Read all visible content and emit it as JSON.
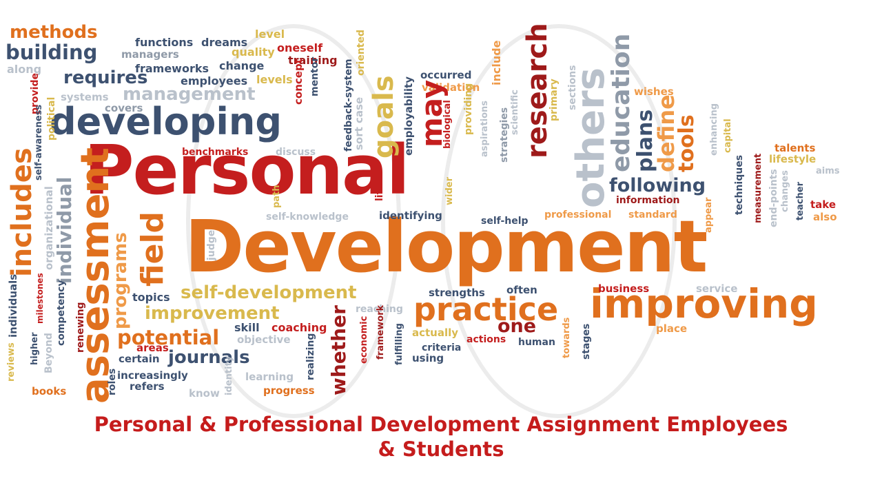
{
  "colors": {
    "red": "#c41e1e",
    "dark_red": "#9e1a1a",
    "orange": "#e0701e",
    "light_orange": "#ef9a48",
    "slate": "#3d5170",
    "gray": "#8f9aa8",
    "light_gray": "#b9c1cb",
    "gold": "#d9b94d",
    "caption": "#c51c1c"
  },
  "words": [
    {
      "t": "methods",
      "c": "orange"
    },
    {
      "t": "building",
      "c": "slate"
    },
    {
      "t": "along",
      "c": "light_gray"
    },
    {
      "t": "functions",
      "c": "slate"
    },
    {
      "t": "dreams",
      "c": "slate"
    },
    {
      "t": "managers",
      "c": "gray"
    },
    {
      "t": "frameworks",
      "c": "slate"
    },
    {
      "t": "change",
      "c": "slate"
    },
    {
      "t": "level",
      "c": "gold"
    },
    {
      "t": "quality",
      "c": "gold"
    },
    {
      "t": "oneself",
      "c": "red"
    },
    {
      "t": "training",
      "c": "dark_red"
    },
    {
      "t": "levels",
      "c": "gold"
    },
    {
      "t": "requires",
      "c": "slate"
    },
    {
      "t": "employees",
      "c": "slate"
    },
    {
      "t": "management",
      "c": "light_gray"
    },
    {
      "t": "systems",
      "c": "light_gray"
    },
    {
      "t": "covers",
      "c": "gray"
    },
    {
      "t": "developing",
      "c": "slate"
    },
    {
      "t": "benchmarks",
      "c": "red"
    },
    {
      "t": "discuss",
      "c": "light_gray"
    },
    {
      "t": "Personal",
      "c": "red"
    },
    {
      "t": "Development",
      "c": "orange"
    },
    {
      "t": "self-knowledge",
      "c": "light_gray"
    },
    {
      "t": "path",
      "c": "gold"
    },
    {
      "t": "identifying",
      "c": "slate"
    },
    {
      "t": "self-help",
      "c": "slate"
    },
    {
      "t": "professional",
      "c": "light_orange"
    },
    {
      "t": "standard",
      "c": "light_orange"
    },
    {
      "t": "topics",
      "c": "slate"
    },
    {
      "t": "self-development",
      "c": "gold"
    },
    {
      "t": "improvement",
      "c": "gold"
    },
    {
      "t": "reaching",
      "c": "light_gray"
    },
    {
      "t": "strengths",
      "c": "slate"
    },
    {
      "t": "often",
      "c": "slate"
    },
    {
      "t": "practice",
      "c": "orange"
    },
    {
      "t": "improving",
      "c": "orange"
    },
    {
      "t": "business",
      "c": "red"
    },
    {
      "t": "service",
      "c": "light_gray"
    },
    {
      "t": "one",
      "c": "dark_red"
    },
    {
      "t": "actually",
      "c": "gold"
    },
    {
      "t": "actions",
      "c": "red"
    },
    {
      "t": "human",
      "c": "slate"
    },
    {
      "t": "criteria",
      "c": "slate"
    },
    {
      "t": "using",
      "c": "slate"
    },
    {
      "t": "place",
      "c": "light_orange"
    },
    {
      "t": "skill",
      "c": "slate"
    },
    {
      "t": "coaching",
      "c": "red"
    },
    {
      "t": "potential",
      "c": "orange"
    },
    {
      "t": "objective",
      "c": "light_gray"
    },
    {
      "t": "areas",
      "c": "red"
    },
    {
      "t": "certain",
      "c": "slate"
    },
    {
      "t": "journals",
      "c": "slate"
    },
    {
      "t": "increasingly",
      "c": "slate"
    },
    {
      "t": "refers",
      "c": "slate"
    },
    {
      "t": "learning",
      "c": "light_gray"
    },
    {
      "t": "know",
      "c": "light_gray"
    },
    {
      "t": "progress",
      "c": "orange"
    },
    {
      "t": "books",
      "c": "orange"
    },
    {
      "t": "following",
      "c": "slate"
    },
    {
      "t": "information",
      "c": "dark_red"
    },
    {
      "t": "wishes",
      "c": "light_orange"
    },
    {
      "t": "talents",
      "c": "orange"
    },
    {
      "t": "lifestyle",
      "c": "gold"
    },
    {
      "t": "aims",
      "c": "light_gray"
    },
    {
      "t": "take",
      "c": "red"
    },
    {
      "t": "also",
      "c": "light_orange"
    },
    {
      "t": "occurred",
      "c": "slate"
    },
    {
      "t": "validation",
      "c": "light_orange"
    },
    {
      "t": "concept",
      "c": "red"
    },
    {
      "t": "goals",
      "c": "gold"
    },
    {
      "t": "research",
      "c": "dark_red"
    },
    {
      "t": "may",
      "c": "red"
    },
    {
      "t": "others",
      "c": "light_gray"
    },
    {
      "t": "education",
      "c": "gray"
    },
    {
      "t": "plans",
      "c": "slate"
    },
    {
      "t": "define",
      "c": "light_orange"
    },
    {
      "t": "tools",
      "c": "orange"
    },
    {
      "t": "includes",
      "c": "orange"
    },
    {
      "t": "assessment",
      "c": "orange"
    },
    {
      "t": "field",
      "c": "orange"
    },
    {
      "t": "individual",
      "c": "gray"
    },
    {
      "t": "programs",
      "c": "light_orange"
    },
    {
      "t": "whether",
      "c": "dark_red"
    },
    {
      "t": "include",
      "c": "light_orange"
    },
    {
      "t": "oriented",
      "c": "gold"
    },
    {
      "t": "mentor",
      "c": "slate"
    },
    {
      "t": "feedback-system",
      "c": "slate"
    },
    {
      "t": "sort case",
      "c": "light_gray"
    },
    {
      "t": "employability",
      "c": "slate"
    },
    {
      "t": "biological",
      "c": "red"
    },
    {
      "t": "providing",
      "c": "gold"
    },
    {
      "t": "aspirations",
      "c": "light_gray"
    },
    {
      "t": "strategies",
      "c": "gray"
    },
    {
      "t": "scientific",
      "c": "light_gray"
    },
    {
      "t": "primary",
      "c": "gold"
    },
    {
      "t": "sections",
      "c": "light_gray"
    },
    {
      "t": "enhancing",
      "c": "light_gray"
    },
    {
      "t": "capital",
      "c": "gold"
    },
    {
      "t": "techniques",
      "c": "slate"
    },
    {
      "t": "appear",
      "c": "light_orange"
    },
    {
      "t": "measurement",
      "c": "dark_red"
    },
    {
      "t": "end-points",
      "c": "light_gray"
    },
    {
      "t": "changes",
      "c": "light_gray"
    },
    {
      "t": "teacher",
      "c": "slate"
    },
    {
      "t": "provide",
      "c": "red"
    },
    {
      "t": "self-awareness",
      "c": "slate"
    },
    {
      "t": "political",
      "c": "gold"
    },
    {
      "t": "organizational",
      "c": "light_gray"
    },
    {
      "t": "life",
      "c": "red"
    },
    {
      "t": "wider",
      "c": "gold"
    },
    {
      "t": "judge",
      "c": "light_gray"
    },
    {
      "t": "economic",
      "c": "red"
    },
    {
      "t": "framework",
      "c": "dark_red"
    },
    {
      "t": "fulfilling",
      "c": "slate"
    },
    {
      "t": "realizing",
      "c": "slate"
    },
    {
      "t": "identity",
      "c": "light_gray"
    },
    {
      "t": "roles",
      "c": "slate"
    },
    {
      "t": "towards",
      "c": "light_orange"
    },
    {
      "t": "stages",
      "c": "slate"
    },
    {
      "t": "reviews",
      "c": "gold"
    },
    {
      "t": "individuals",
      "c": "slate"
    },
    {
      "t": "higher",
      "c": "slate"
    },
    {
      "t": "milestones",
      "c": "red"
    },
    {
      "t": "Beyond",
      "c": "light_gray"
    },
    {
      "t": "competency",
      "c": "slate"
    },
    {
      "t": "renewing",
      "c": "dark_red"
    }
  ],
  "caption": {
    "line1": "Personal & Professional Development Assignment Employees",
    "line2": "& Students"
  }
}
